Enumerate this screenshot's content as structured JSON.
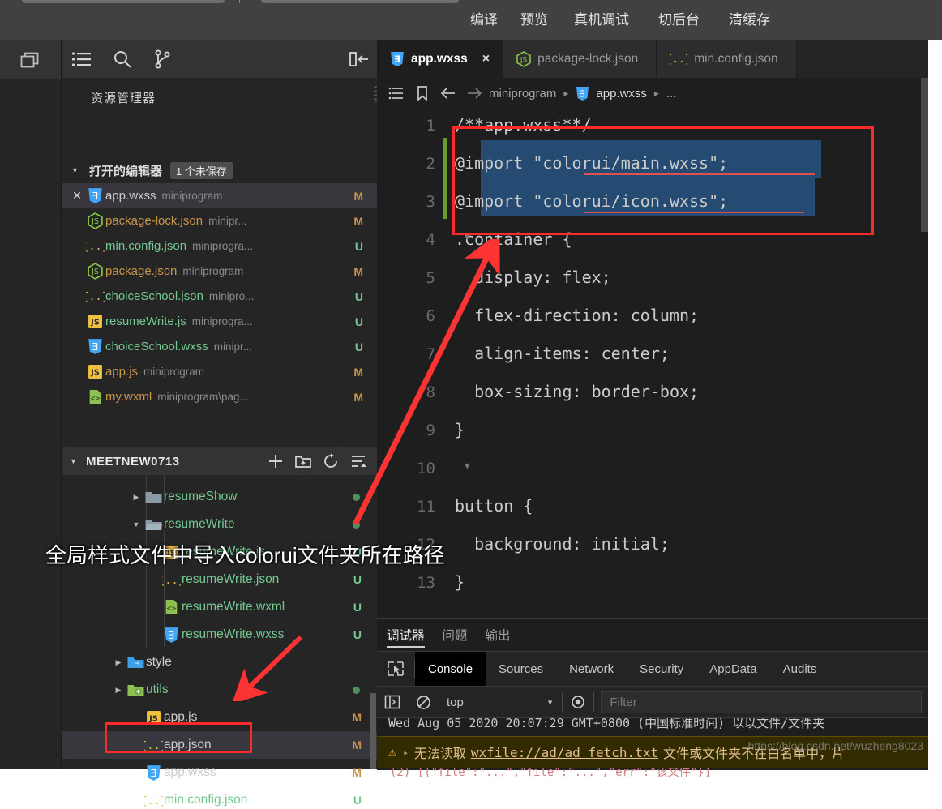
{
  "toolbar": {
    "buttons": [
      "编译",
      "预览",
      "真机调试",
      "切后台",
      "清缓存"
    ]
  },
  "activitybar": {
    "icon": "multi-window-icon"
  },
  "sidebar": {
    "tools": [
      "list-icon",
      "search-icon",
      "source-control-icon"
    ],
    "collapse_icon": "collapse-panel-icon",
    "title": "资源管理器",
    "open_editors": {
      "label": "打开的编辑器",
      "badge": "1 个未保存",
      "items": [
        {
          "name": "app.wxss",
          "path": "miniprogram",
          "status": "M",
          "icon": "wxss-icon",
          "active": true,
          "name_class": "n-plain"
        },
        {
          "name": "package-lock.json",
          "path": "minipr...",
          "status": "M",
          "icon": "nodejs-icon",
          "active": false,
          "name_class": "n-mod"
        },
        {
          "name": "min.config.json",
          "path": "miniprogra...",
          "status": "U",
          "icon": "json-icon",
          "active": false,
          "name_class": "n-new"
        },
        {
          "name": "package.json",
          "path": "miniprogram",
          "status": "M",
          "icon": "nodejs-icon",
          "active": false,
          "name_class": "n-mod"
        },
        {
          "name": "choiceSchool.json",
          "path": "minipro...",
          "status": "U",
          "icon": "json-icon",
          "active": false,
          "name_class": "n-new"
        },
        {
          "name": "resumeWrite.js",
          "path": "miniprogra...",
          "status": "U",
          "icon": "js-icon",
          "active": false,
          "name_class": "n-new"
        },
        {
          "name": "choiceSchool.wxss",
          "path": "minipr...",
          "status": "U",
          "icon": "wxss-icon",
          "active": false,
          "name_class": "n-new"
        },
        {
          "name": "app.js",
          "path": "miniprogram",
          "status": "M",
          "icon": "js-icon",
          "active": false,
          "name_class": "n-mod"
        },
        {
          "name": "my.wxml",
          "path": "miniprogram\\pag...",
          "status": "M",
          "icon": "wxml-icon",
          "active": false,
          "name_class": "n-mod"
        }
      ]
    },
    "project": {
      "name": "MEETNEW0713",
      "tools": [
        "new-file-icon",
        "new-folder-icon",
        "refresh-icon",
        "collapse-all-icon"
      ],
      "tree": [
        {
          "name": "resumeShow",
          "indent": 2,
          "twisty": "▶",
          "icon": "folder-icon",
          "status": "dot",
          "name_class": "n-new",
          "selected": false
        },
        {
          "name": "resumeWrite",
          "indent": 2,
          "twisty": "▼",
          "icon": "folder-open-icon",
          "status": "dot",
          "name_class": "n-new",
          "selected": false
        },
        {
          "name": "resumeWrite.js",
          "indent": 3,
          "twisty": "",
          "icon": "js-icon",
          "status": "U",
          "name_class": "n-new",
          "selected": false
        },
        {
          "name": "resumeWrite.json",
          "indent": 3,
          "twisty": "",
          "icon": "json-icon",
          "status": "U",
          "name_class": "n-new",
          "selected": false
        },
        {
          "name": "resumeWrite.wxml",
          "indent": 3,
          "twisty": "",
          "icon": "wxml-icon",
          "status": "U",
          "name_class": "n-new",
          "selected": false
        },
        {
          "name": "resumeWrite.wxss",
          "indent": 3,
          "twisty": "",
          "icon": "wxss-icon",
          "status": "U",
          "name_class": "n-new",
          "selected": false
        },
        {
          "name": "style",
          "indent": 1,
          "twisty": "▶",
          "icon": "folder-style-icon",
          "status": "",
          "name_class": "n-plain",
          "selected": false
        },
        {
          "name": "utils",
          "indent": 1,
          "twisty": "▶",
          "icon": "folder-utils-icon",
          "status": "dot",
          "name_class": "n-new",
          "selected": false
        },
        {
          "name": "app.js",
          "indent": 2,
          "twisty": "",
          "icon": "js-icon",
          "status": "M",
          "name_class": "n-plain",
          "selected": false
        },
        {
          "name": "app.json",
          "indent": 2,
          "twisty": "",
          "icon": "json-icon",
          "status": "M",
          "name_class": "n-plain",
          "selected": true
        },
        {
          "name": "app.wxss",
          "indent": 2,
          "twisty": "",
          "icon": "wxss-icon",
          "status": "M",
          "name_class": "n-plain",
          "selected": false
        },
        {
          "name": "min.config.json",
          "indent": 2,
          "twisty": "",
          "icon": "json-icon",
          "status": "U",
          "name_class": "n-new",
          "selected": false
        }
      ]
    }
  },
  "editor": {
    "tabs": [
      {
        "label": "app.wxss",
        "icon": "wxss-icon",
        "active": true,
        "close": "×"
      },
      {
        "label": "package-lock.json",
        "icon": "nodejs-icon",
        "active": false,
        "close": ""
      },
      {
        "label": "min.config.json",
        "icon": "json-icon",
        "active": false,
        "close": ""
      }
    ],
    "breadcrumb": {
      "icons": [
        "outline-icon",
        "bookmark-icon",
        "back-arrow-icon",
        "forward-arrow-icon"
      ],
      "parts": [
        "miniprogram",
        "app.wxss",
        "..."
      ],
      "separator": "▸"
    },
    "code_lines": [
      {
        "n": "1",
        "text": "/**app.wxss**/"
      },
      {
        "n": "2",
        "text": "@import \"colorui/main.wxss\";"
      },
      {
        "n": "3",
        "text": "@import \"colorui/icon.wxss\";"
      },
      {
        "n": "4",
        "text": ".container {"
      },
      {
        "n": "5",
        "text": "  display: flex;"
      },
      {
        "n": "6",
        "text": "  flex-direction: column;"
      },
      {
        "n": "7",
        "text": "  align-items: center;"
      },
      {
        "n": "8",
        "text": "  box-sizing: border-box;"
      },
      {
        "n": "9",
        "text": "}"
      },
      {
        "n": "10",
        "text": ""
      },
      {
        "n": "11",
        "text": "button {"
      },
      {
        "n": "12",
        "text": "  background: initial;"
      },
      {
        "n": "13",
        "text": "}"
      }
    ]
  },
  "annotation": {
    "text": "全局样式文件中导入colorui文件夹所在路径",
    "box_color": "#fc2a2a",
    "arrow_color": "#fc3333"
  },
  "panel": {
    "tabs": [
      {
        "label": "调试器",
        "active": true
      },
      {
        "label": "问题",
        "active": false
      },
      {
        "label": "输出",
        "active": false
      }
    ],
    "devtools": {
      "picker_icon": "element-picker-icon",
      "tabs": [
        {
          "label": "Console",
          "active": true
        },
        {
          "label": "Sources",
          "active": false
        },
        {
          "label": "Network",
          "active": false
        },
        {
          "label": "Security",
          "active": false
        },
        {
          "label": "AppData",
          "active": false
        },
        {
          "label": "Audits",
          "active": false
        }
      ],
      "bar": {
        "sidebar_icon": "console-sidebar-icon",
        "clear_icon": "clear-console-icon",
        "context": "top",
        "caret": "▾",
        "eye_icon": "live-expression-icon",
        "filter_placeholder": "Filter"
      }
    },
    "console": {
      "partial_top": "Wed Aug 05 2020 20:07:29 GMT+0800 (中国标准时间) 以以文件/文件夹",
      "warning": {
        "icon": "warning-icon",
        "expander": "▸",
        "prefix": "无法读取",
        "link": "wxfile://ad/ad_fetch.txt",
        "suffix": "文件或文件夹不在白名单中，片"
      },
      "partial_bottom": "(2) [{\"file\":\"...\",\"file\":\"...\",\"err\":\"该文件\"}]"
    },
    "watermark": "https://blog.csdn.net/wuzheng8023"
  }
}
